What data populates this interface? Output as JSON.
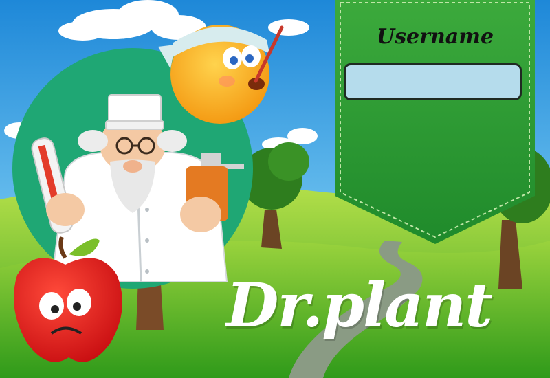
{
  "login_panel": {
    "username_label": "Username",
    "username_value": "",
    "panel_color": "#2f9a34",
    "input_color": "#b5dcec"
  },
  "title": "Dr.plant",
  "icons": [
    "doctor-icon",
    "thermometer-icon",
    "medicine-bottle-icon",
    "sick-sun-icon",
    "sick-apple-icon",
    "tree-icon",
    "cloud-icon",
    "path-icon"
  ],
  "colors": {
    "sky": "#5fb2e8",
    "grass": "#4cae28",
    "medallion": "#1fa774"
  }
}
